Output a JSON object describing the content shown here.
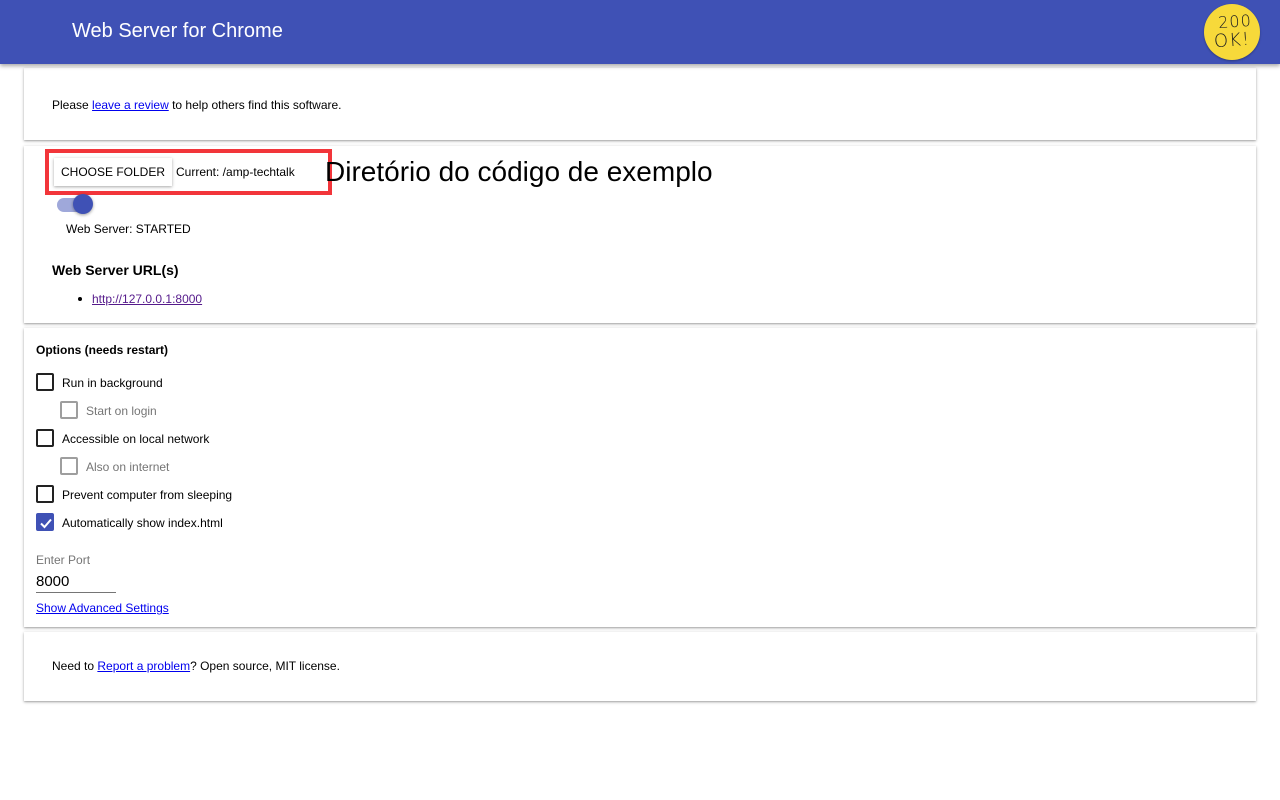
{
  "header": {
    "title": "Web Server for Chrome",
    "logo_line1": "200",
    "logo_line2": "OK!",
    "color": "#3f51b5"
  },
  "review_card": {
    "prefix": "Please ",
    "link": "leave a review",
    "suffix": " to help others find this software."
  },
  "server_card": {
    "choose_folder_label": "CHOOSE FOLDER",
    "current_folder": "Current: /amp-techtalk",
    "annotation": "Diretório do código de exemplo",
    "annotation_box_color": "#f2353a",
    "toggle_on": true,
    "status": "Web Server: STARTED",
    "urls_heading": "Web Server URL(s)",
    "urls": [
      "http://127.0.0.1:8000"
    ]
  },
  "options": {
    "title": "Options (needs restart)",
    "items": [
      {
        "label": "Run in background",
        "checked": false,
        "disabled": false
      },
      {
        "label": "Start on login",
        "checked": false,
        "disabled": true
      },
      {
        "label": "Accessible on local network",
        "checked": false,
        "disabled": false
      },
      {
        "label": "Also on internet",
        "checked": false,
        "disabled": true
      },
      {
        "label": "Prevent computer from sleeping",
        "checked": false,
        "disabled": false
      },
      {
        "label": "Automatically show index.html",
        "checked": true,
        "disabled": false
      }
    ],
    "port_label": "Enter Port",
    "port_value": "8000",
    "advanced_link": "Show Advanced Settings"
  },
  "footer_card": {
    "prefix": "Need to ",
    "link": "Report a problem",
    "suffix": "? Open source, MIT license."
  }
}
